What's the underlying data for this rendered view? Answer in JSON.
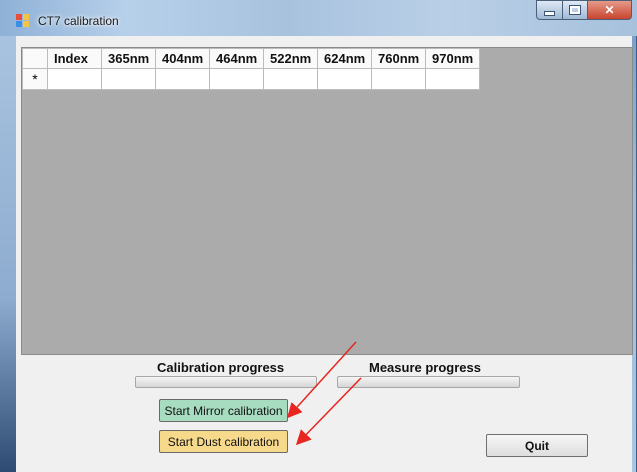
{
  "window": {
    "title": "CT7 calibration"
  },
  "grid": {
    "columns": [
      "Index",
      "365nm",
      "404nm",
      "464nm",
      "522nm",
      "624nm",
      "760nm",
      "970nm"
    ],
    "new_row_marker": "*"
  },
  "progress": {
    "calibration_label": "Calibration progress",
    "calibration_value": 0,
    "measure_label": "Measure progress",
    "measure_value": 0
  },
  "buttons": {
    "mirror": "Start Mirror calibration",
    "dust": "Start Dust calibration",
    "quit": "Quit"
  },
  "colors": {
    "mirror_button": "#a8dcc0",
    "dust_button": "#f7d98c",
    "annotation_arrow": "#e8251f"
  }
}
